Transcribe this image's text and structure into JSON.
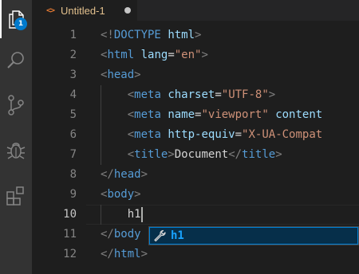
{
  "activity_bar": {
    "items": [
      {
        "name": "explorer",
        "icon": "files-icon",
        "active": true
      },
      {
        "name": "search",
        "icon": "search-icon",
        "active": false
      },
      {
        "name": "source-control",
        "icon": "source-control-icon",
        "active": false
      },
      {
        "name": "debug",
        "icon": "debug-icon",
        "active": false
      },
      {
        "name": "extensions",
        "icon": "extensions-icon",
        "active": false
      }
    ],
    "explorer_badge": "1"
  },
  "tab": {
    "icon": "<>",
    "title": "Untitled-1",
    "dirty": true
  },
  "editor": {
    "current_line": 10,
    "lines": [
      {
        "number": "1",
        "tokens": [
          {
            "t": "<!",
            "c": "punc"
          },
          {
            "t": "DOCTYPE",
            "c": "tag"
          },
          {
            "t": " ",
            "c": "text"
          },
          {
            "t": "html",
            "c": "attr"
          },
          {
            "t": ">",
            "c": "punc"
          }
        ]
      },
      {
        "number": "2",
        "tokens": [
          {
            "t": "<",
            "c": "punc"
          },
          {
            "t": "html",
            "c": "tag"
          },
          {
            "t": " ",
            "c": "text"
          },
          {
            "t": "lang",
            "c": "attr"
          },
          {
            "t": "=",
            "c": "text"
          },
          {
            "t": "\"en\"",
            "c": "str"
          },
          {
            "t": ">",
            "c": "punc"
          }
        ]
      },
      {
        "number": "3",
        "tokens": [
          {
            "t": "<",
            "c": "punc"
          },
          {
            "t": "head",
            "c": "tag"
          },
          {
            "t": ">",
            "c": "punc"
          }
        ]
      },
      {
        "number": "4",
        "tokens": [
          {
            "t": "    ",
            "c": "text"
          },
          {
            "t": "<",
            "c": "punc"
          },
          {
            "t": "meta",
            "c": "tag"
          },
          {
            "t": " ",
            "c": "text"
          },
          {
            "t": "charset",
            "c": "attr"
          },
          {
            "t": "=",
            "c": "text"
          },
          {
            "t": "\"UTF-8\"",
            "c": "str"
          },
          {
            "t": ">",
            "c": "punc"
          }
        ]
      },
      {
        "number": "5",
        "tokens": [
          {
            "t": "    ",
            "c": "text"
          },
          {
            "t": "<",
            "c": "punc"
          },
          {
            "t": "meta",
            "c": "tag"
          },
          {
            "t": " ",
            "c": "text"
          },
          {
            "t": "name",
            "c": "attr"
          },
          {
            "t": "=",
            "c": "text"
          },
          {
            "t": "\"viewport\"",
            "c": "str"
          },
          {
            "t": " ",
            "c": "text"
          },
          {
            "t": "content",
            "c": "attr"
          }
        ]
      },
      {
        "number": "6",
        "tokens": [
          {
            "t": "    ",
            "c": "text"
          },
          {
            "t": "<",
            "c": "punc"
          },
          {
            "t": "meta",
            "c": "tag"
          },
          {
            "t": " ",
            "c": "text"
          },
          {
            "t": "http-equiv",
            "c": "attr"
          },
          {
            "t": "=",
            "c": "text"
          },
          {
            "t": "\"X-UA-Compat",
            "c": "str"
          }
        ]
      },
      {
        "number": "7",
        "tokens": [
          {
            "t": "    ",
            "c": "text"
          },
          {
            "t": "<",
            "c": "punc"
          },
          {
            "t": "title",
            "c": "tag"
          },
          {
            "t": ">",
            "c": "punc"
          },
          {
            "t": "Document",
            "c": "text"
          },
          {
            "t": "</",
            "c": "punc"
          },
          {
            "t": "title",
            "c": "tag"
          },
          {
            "t": ">",
            "c": "punc"
          }
        ]
      },
      {
        "number": "8",
        "tokens": [
          {
            "t": "</",
            "c": "punc"
          },
          {
            "t": "head",
            "c": "tag"
          },
          {
            "t": ">",
            "c": "punc"
          }
        ]
      },
      {
        "number": "9",
        "tokens": [
          {
            "t": "<",
            "c": "punc"
          },
          {
            "t": "body",
            "c": "tag"
          },
          {
            "t": ">",
            "c": "punc"
          }
        ]
      },
      {
        "number": "10",
        "tokens": [
          {
            "t": "    ",
            "c": "text"
          },
          {
            "t": "h1",
            "c": "text"
          }
        ]
      },
      {
        "number": "11",
        "tokens": [
          {
            "t": "</",
            "c": "punc"
          },
          {
            "t": "body",
            "c": "tag"
          }
        ]
      },
      {
        "number": "12",
        "tokens": [
          {
            "t": "</",
            "c": "punc"
          },
          {
            "t": "html",
            "c": "tag"
          },
          {
            "t": ">",
            "c": "punc"
          }
        ]
      }
    ]
  },
  "suggest": {
    "icon": "wrench-icon",
    "label": "h1"
  },
  "colors": {
    "background": "#1e1e1e",
    "activity_bar": "#333333",
    "badge": "#007acc",
    "tag": "#569cd6",
    "attribute": "#9cdcfe",
    "string": "#ce9178",
    "punctuation": "#808080",
    "suggest_highlight": "#18a3ff",
    "tab_title": "#e2c08d"
  }
}
